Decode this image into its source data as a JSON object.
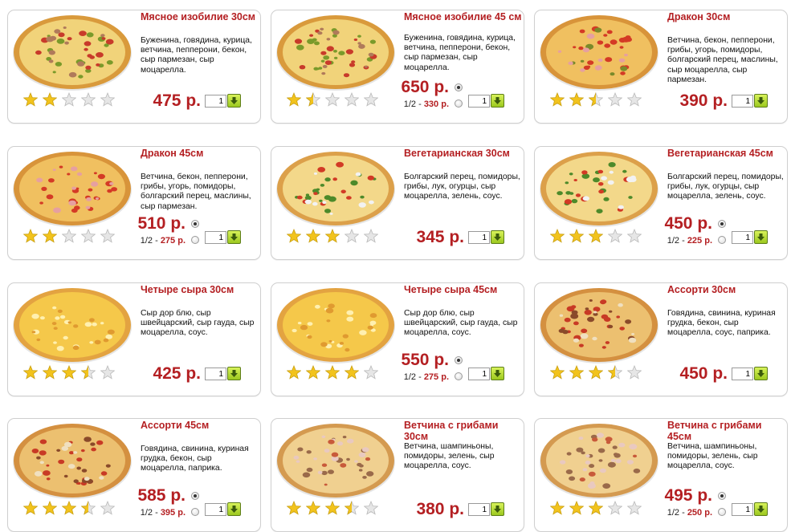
{
  "colors": {
    "accent": "#b41f22",
    "star_filled": "#f2c31c",
    "star_empty": "#e6e6e6",
    "cart_button": "#a8d028"
  },
  "products": [
    {
      "title": "Мясное изобилие 30см",
      "description": "Буженина, говядина, курица, ветчина, пепперони, бекон, сыр пармезан, сыр моцарелла.",
      "rating": 2,
      "price": "475 р.",
      "half_price": null,
      "qty": "1",
      "icon": "add-to-cart-icon"
    },
    {
      "title": "Мясное изобилие 45 см",
      "description": "Буженина, говядина, курица, ветчина, пепперони, бекон, сыр пармезан, сыр моцарелла.",
      "rating": 1.5,
      "price": "650 р.",
      "half_label": "1/2 - ",
      "half_price": "330 р.",
      "qty": "1",
      "icon": "add-to-cart-icon"
    },
    {
      "title": "Дракон 30см",
      "description": "Ветчина, бекон, пепперони, грибы, угорь, помидоры, болгарский перец, маслины, сыр моцарелла, сыр пармезан.",
      "rating": 2.5,
      "price": "390 р.",
      "half_price": null,
      "qty": "1",
      "icon": "add-to-cart-icon"
    },
    {
      "title": "Дракон 45см",
      "description": "Ветчина, бекон, пепперони, грибы, угорь, помидоры, болгарский перец, маслины, сыр пармезан.",
      "rating": 2,
      "price": "510 р.",
      "half_label": "1/2 - ",
      "half_price": "275 р.",
      "qty": "1",
      "icon": "add-to-cart-icon"
    },
    {
      "title": "Вегетарианская 30см",
      "description": "Болгарский перец, помидоры, грибы, лук, огурцы, сыр моцарелла, зелень, соус.",
      "rating": 3,
      "price": "345 р.",
      "half_price": null,
      "qty": "1",
      "icon": "add-to-cart-icon"
    },
    {
      "title": "Вегетарианская 45см",
      "description": "Болгарский перец, помидоры, грибы, лук, огурцы, сыр моцарелла, зелень, соус.",
      "rating": 3,
      "price": "450 р.",
      "half_label": "1/2 - ",
      "half_price": "225 р.",
      "qty": "1",
      "icon": "add-to-cart-icon"
    },
    {
      "title": "Четыре сыра 30см",
      "description": "Сыр дор блю, сыр швейцарский, сыр гауда, сыр моцарелла, соус.",
      "rating": 3.5,
      "price": "425 р.",
      "half_price": null,
      "qty": "1",
      "icon": "add-to-cart-icon"
    },
    {
      "title": "Четыре сыра 45см",
      "description": "Сыр дор блю, сыр швейцарский, сыр гауда, сыр моцарелла, соус.",
      "rating": 4,
      "price": "550 р.",
      "half_label": "1/2 - ",
      "half_price": "275 р.",
      "qty": "1",
      "icon": "add-to-cart-icon"
    },
    {
      "title": "Ассорти 30см",
      "description": "Говядина, свинина, куриная грудка, бекон, сыр моцарелла, соус, паприка.",
      "rating": 3.5,
      "price": "450 р.",
      "half_price": null,
      "qty": "1",
      "icon": "add-to-cart-icon"
    },
    {
      "title": "Ассорти 45см",
      "description": "Говядина, свинина, куриная грудка, бекон, сыр моцарелла, паприка.",
      "rating": 3.5,
      "price": "585 р.",
      "half_label": "1/2 - ",
      "half_price": "395 р.",
      "qty": "1",
      "icon": "add-to-cart-icon"
    },
    {
      "title": "Ветчина с грибами 30см",
      "description": "Ветчина, шампиньоны, помидоры, зелень, сыр моцарелла, соус.",
      "rating": 3.5,
      "price": "380 р.",
      "half_price": null,
      "qty": "1",
      "icon": "add-to-cart-icon"
    },
    {
      "title": "Ветчина с грибами 45см",
      "description": "Ветчина, шампиньоны, помидоры, зелень, сыр моцарелла, соус.",
      "rating": 3,
      "price": "495 р.",
      "half_label": "1/2 - ",
      "half_price": "250 р.",
      "qty": "1",
      "icon": "add-to-cart-icon"
    }
  ]
}
